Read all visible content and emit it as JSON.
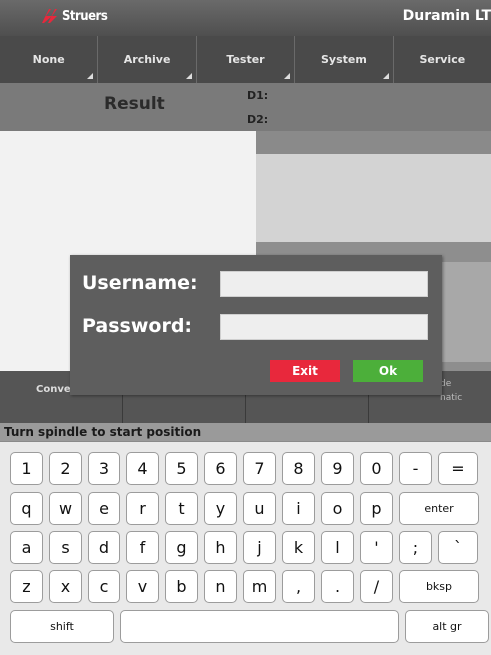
{
  "header": {
    "logo_text": "Struers",
    "brand": "Duramin LT"
  },
  "menu": [
    {
      "label": "None"
    },
    {
      "label": "Archive"
    },
    {
      "label": "Tester"
    },
    {
      "label": "System"
    },
    {
      "label": "Service"
    }
  ],
  "result": {
    "title": "Result",
    "d1": "D1:",
    "d2": "D2:"
  },
  "bottom_row": {
    "left_label": "Conve",
    "right_label_1": "de",
    "right_label_2": "natic"
  },
  "status": "Turn spindle to start position",
  "dialog": {
    "username_label": "Username:",
    "username_value": "",
    "password_label": "Password:",
    "password_value": "",
    "exit_label": "Exit",
    "ok_label": "Ok",
    "exit_color": "#e8283c",
    "ok_color": "#4caf3a"
  },
  "keyboard": {
    "row1": [
      "1",
      "2",
      "3",
      "4",
      "5",
      "6",
      "7",
      "8",
      "9",
      "0",
      "-",
      "="
    ],
    "row2": [
      "q",
      "w",
      "e",
      "r",
      "t",
      "y",
      "u",
      "i",
      "o",
      "p",
      "enter"
    ],
    "row3": [
      "a",
      "s",
      "d",
      "f",
      "g",
      "h",
      "j",
      "k",
      "l",
      "'",
      ";",
      "`"
    ],
    "row4": [
      "z",
      "x",
      "c",
      "v",
      "b",
      "n",
      "m",
      ",",
      ".",
      "/",
      "bksp"
    ],
    "row5": [
      "shift",
      "",
      "alt gr"
    ]
  }
}
